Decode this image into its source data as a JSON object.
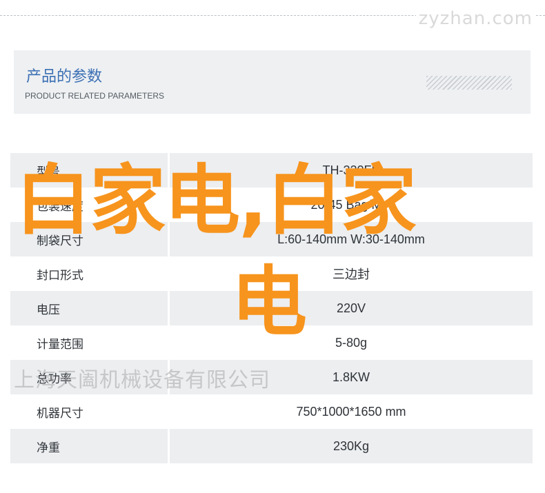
{
  "watermark_top": "zyzhan.com",
  "header": {
    "title": "产品的参数",
    "subtitle": "PRODUCT RELATED PARAMETERS"
  },
  "params": [
    {
      "label": "型号",
      "value": "TH-320FP"
    },
    {
      "label": "包装速度",
      "value": "20-45 Bag/Min"
    },
    {
      "label": "制袋尺寸",
      "value": "L:60-140mm  W:30-140mm"
    },
    {
      "label": "封口形式",
      "value": "三边封"
    },
    {
      "label": "电压",
      "value": "220V"
    },
    {
      "label": "计量范围",
      "value": "5-80g"
    },
    {
      "label": "总功率",
      "value": "1.8KW"
    },
    {
      "label": "机器尺寸",
      "value": "750*1000*1650 mm"
    },
    {
      "label": "净重",
      "value": "230Kg"
    }
  ],
  "overlay": {
    "line1": "白家电,白家",
    "line2": "电"
  },
  "watermark_company": "上海天阖机械设备有限公司",
  "colors": {
    "accent": "#3b6fb3",
    "overlay": "#f7941d",
    "row_shade": "#eceef0"
  }
}
